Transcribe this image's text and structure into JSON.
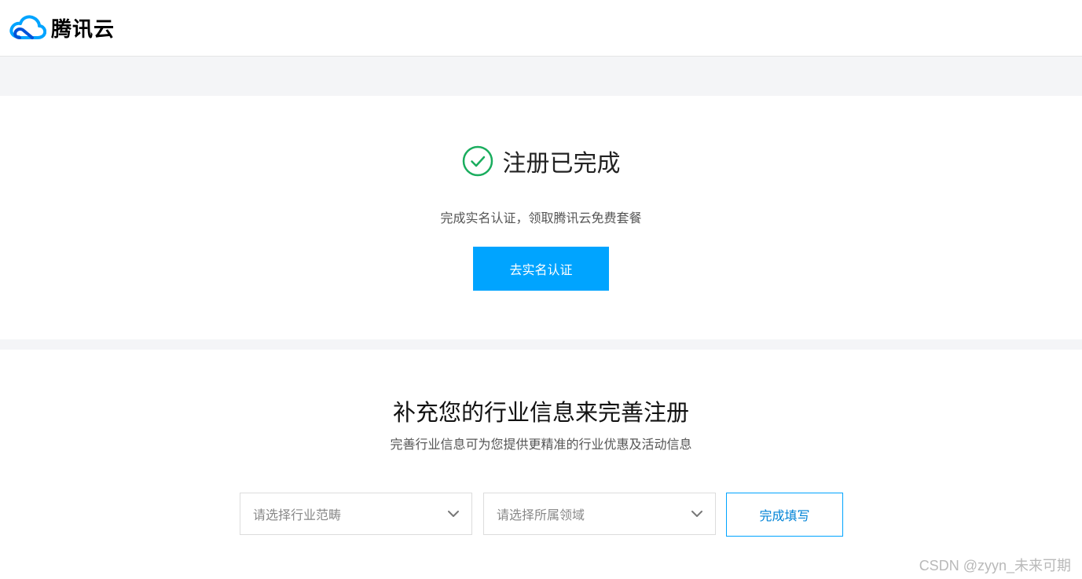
{
  "header": {
    "brand_name": "腾讯云",
    "brand_colors": [
      "#00a4ff",
      "#0052d9"
    ]
  },
  "success": {
    "icon": "check-circle-icon",
    "icon_color": "#1aad5e",
    "title": "注册已完成",
    "subtitle": "完成实名认证，领取腾讯云免费套餐",
    "button_label": "去实名认证"
  },
  "industry": {
    "title": "补充您的行业信息来完善注册",
    "subtitle": "完善行业信息可为您提供更精准的行业优惠及活动信息",
    "select_category_placeholder": "请选择行业范畴",
    "select_domain_placeholder": "请选择所属领域",
    "submit_label": "完成填写"
  },
  "watermark": "CSDN @zyyn_未来可期",
  "accent_color": "#00a4ff"
}
